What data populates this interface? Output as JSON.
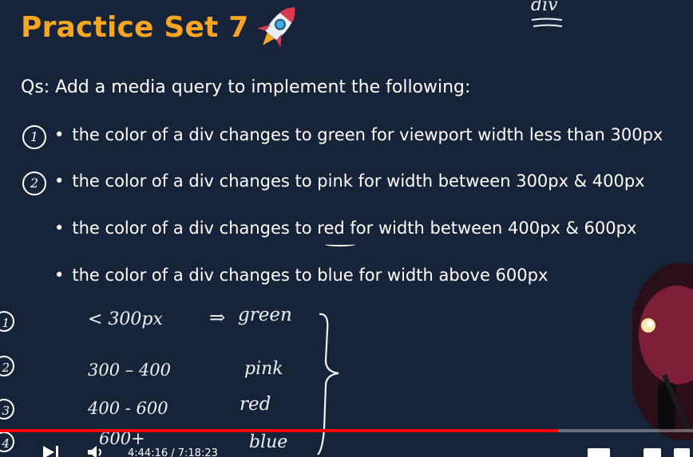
{
  "slide": {
    "title": "Practice Set 7",
    "question": "Qs:  Add a media query to implement the following:",
    "bullets": [
      "the color of a div changes to green for viewport width less than 300px",
      "the color of a div changes to pink for width between 300px & 400px",
      "the color of a div changes to red for width between 400px & 600px",
      "the color of a div changes to blue for width above 600px"
    ],
    "bullet_numbers": [
      "1",
      "2"
    ]
  },
  "annotations": {
    "corner_note": "div",
    "rows": [
      {
        "index": "1",
        "range": "< 300px",
        "arrow": "⇒",
        "color": "green"
      },
      {
        "index": "2",
        "range": "300 – 400",
        "color": "pink"
      },
      {
        "index": "3",
        "range": "400 - 600",
        "color": "red"
      },
      {
        "index": "4",
        "range": "600+",
        "color": "blue"
      }
    ]
  },
  "player": {
    "time": "4:44:16 / 7:18:23",
    "progress": 0.805,
    "progress_color": "#ff0000",
    "accent": "#f6a623"
  }
}
